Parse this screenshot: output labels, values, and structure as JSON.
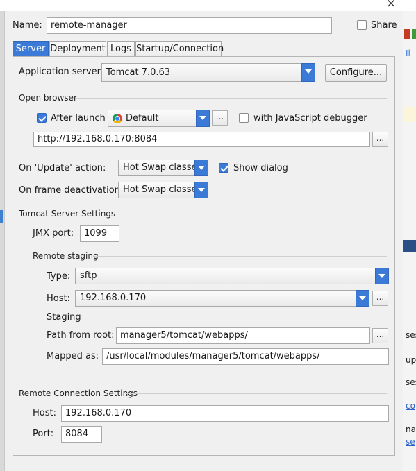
{
  "dialog": {
    "close_glyph": "×",
    "name_label": "Name:",
    "name_value": "remote-manager",
    "share_label": "Share",
    "share_checked": false
  },
  "tabs": [
    {
      "label": "Server",
      "active": true
    },
    {
      "label": "Deployment",
      "active": false
    },
    {
      "label": "Logs",
      "active": false
    },
    {
      "label": "Startup/Connection",
      "active": false
    }
  ],
  "server": {
    "app_server_label": "Application server:",
    "app_server_value": "Tomcat 7.0.63",
    "configure_label": "Configure...",
    "open_browser_title": "Open browser",
    "after_launch_label": "After launch",
    "after_launch_checked": true,
    "browser_value": "Default",
    "browser_icon": "chrome-icon",
    "dots": "...",
    "js_debugger_label": "with JavaScript debugger",
    "js_debugger_checked": false,
    "url_value": "http://192.168.0.170:8084",
    "on_update_label": "On 'Update' action:",
    "on_update_value": "Hot Swap classes",
    "show_dialog_label": "Show dialog",
    "show_dialog_checked": true,
    "on_frame_label": "On frame deactivation:",
    "on_frame_value": "Hot Swap classes"
  },
  "tomcat": {
    "title": "Tomcat Server Settings",
    "jmx_label": "JMX port:",
    "jmx_value": "1099",
    "remote_staging_title": "Remote staging",
    "type_label": "Type:",
    "type_value": "sftp",
    "host_label": "Host:",
    "host_value": "192.168.0.170",
    "staging_title": "Staging",
    "path_label": "Path from root:",
    "path_value": "manager5/tomcat/webapps/",
    "mapped_label": "Mapped as:",
    "mapped_value": "/usr/local/modules/manager5/tomcat/webapps/"
  },
  "remote_conn": {
    "title": "Remote Connection Settings",
    "host_label": "Host:",
    "host_value": "192.168.0.170",
    "port_label": "Port:",
    "port_value": "8084"
  },
  "right_pane": {
    "snippets": [
      "Ii",
      "ses",
      "up-",
      "ses",
      "co",
      "nag",
      "se"
    ]
  },
  "colors": {
    "accent": "#3b7ad6",
    "background": "#f0f0f0"
  }
}
